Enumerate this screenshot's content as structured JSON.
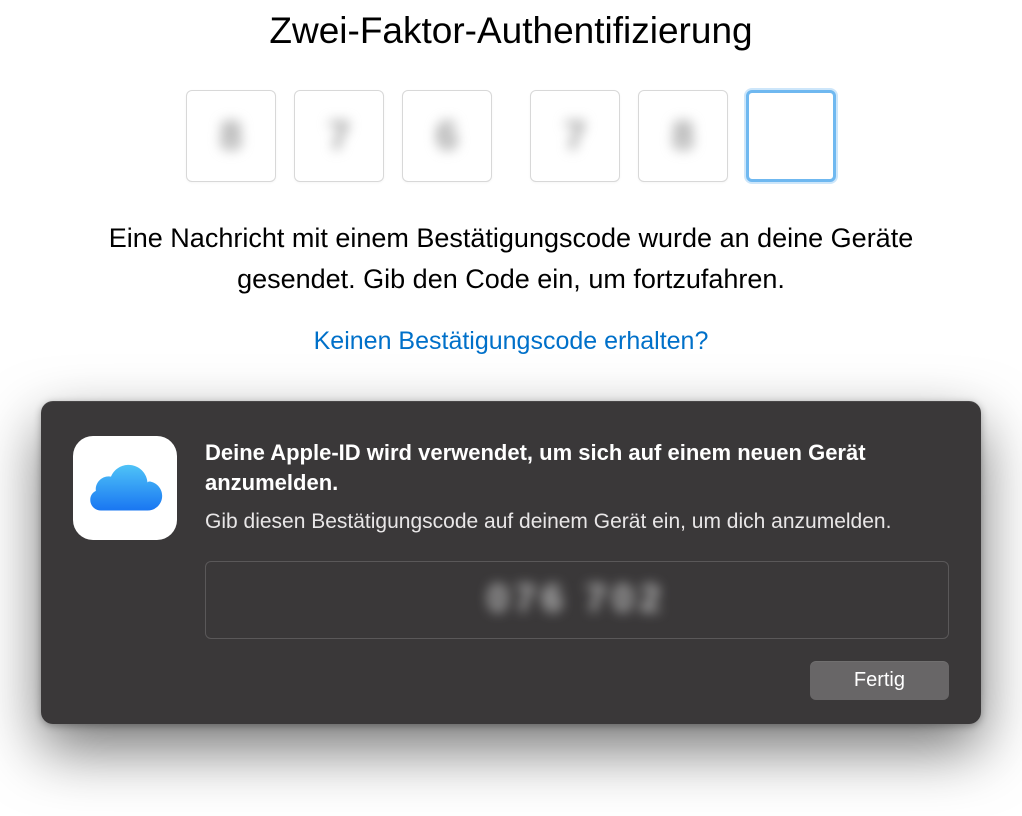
{
  "background": {
    "title": "Zwei-Faktor-Authentifizierung",
    "code_digits": [
      "8",
      "7",
      "6",
      "7",
      "8",
      ""
    ],
    "focused_index": 5,
    "description": "Eine Nachricht mit einem Bestätigungscode wurde an deine Geräte gesendet. Gib den Code ein, um fortzufahren.",
    "link_text": "Keinen Bestätigungscode erhalten?"
  },
  "modal": {
    "icon_name": "icloud-icon",
    "title": "Deine Apple-ID wird verwendet, um sich auf einem neuen Gerät anzumelden.",
    "subtitle": "Gib diesen Bestätigungscode auf deinem Gerät ein, um dich anzumelden.",
    "code_display": "076 702",
    "done_button_label": "Fertig"
  }
}
